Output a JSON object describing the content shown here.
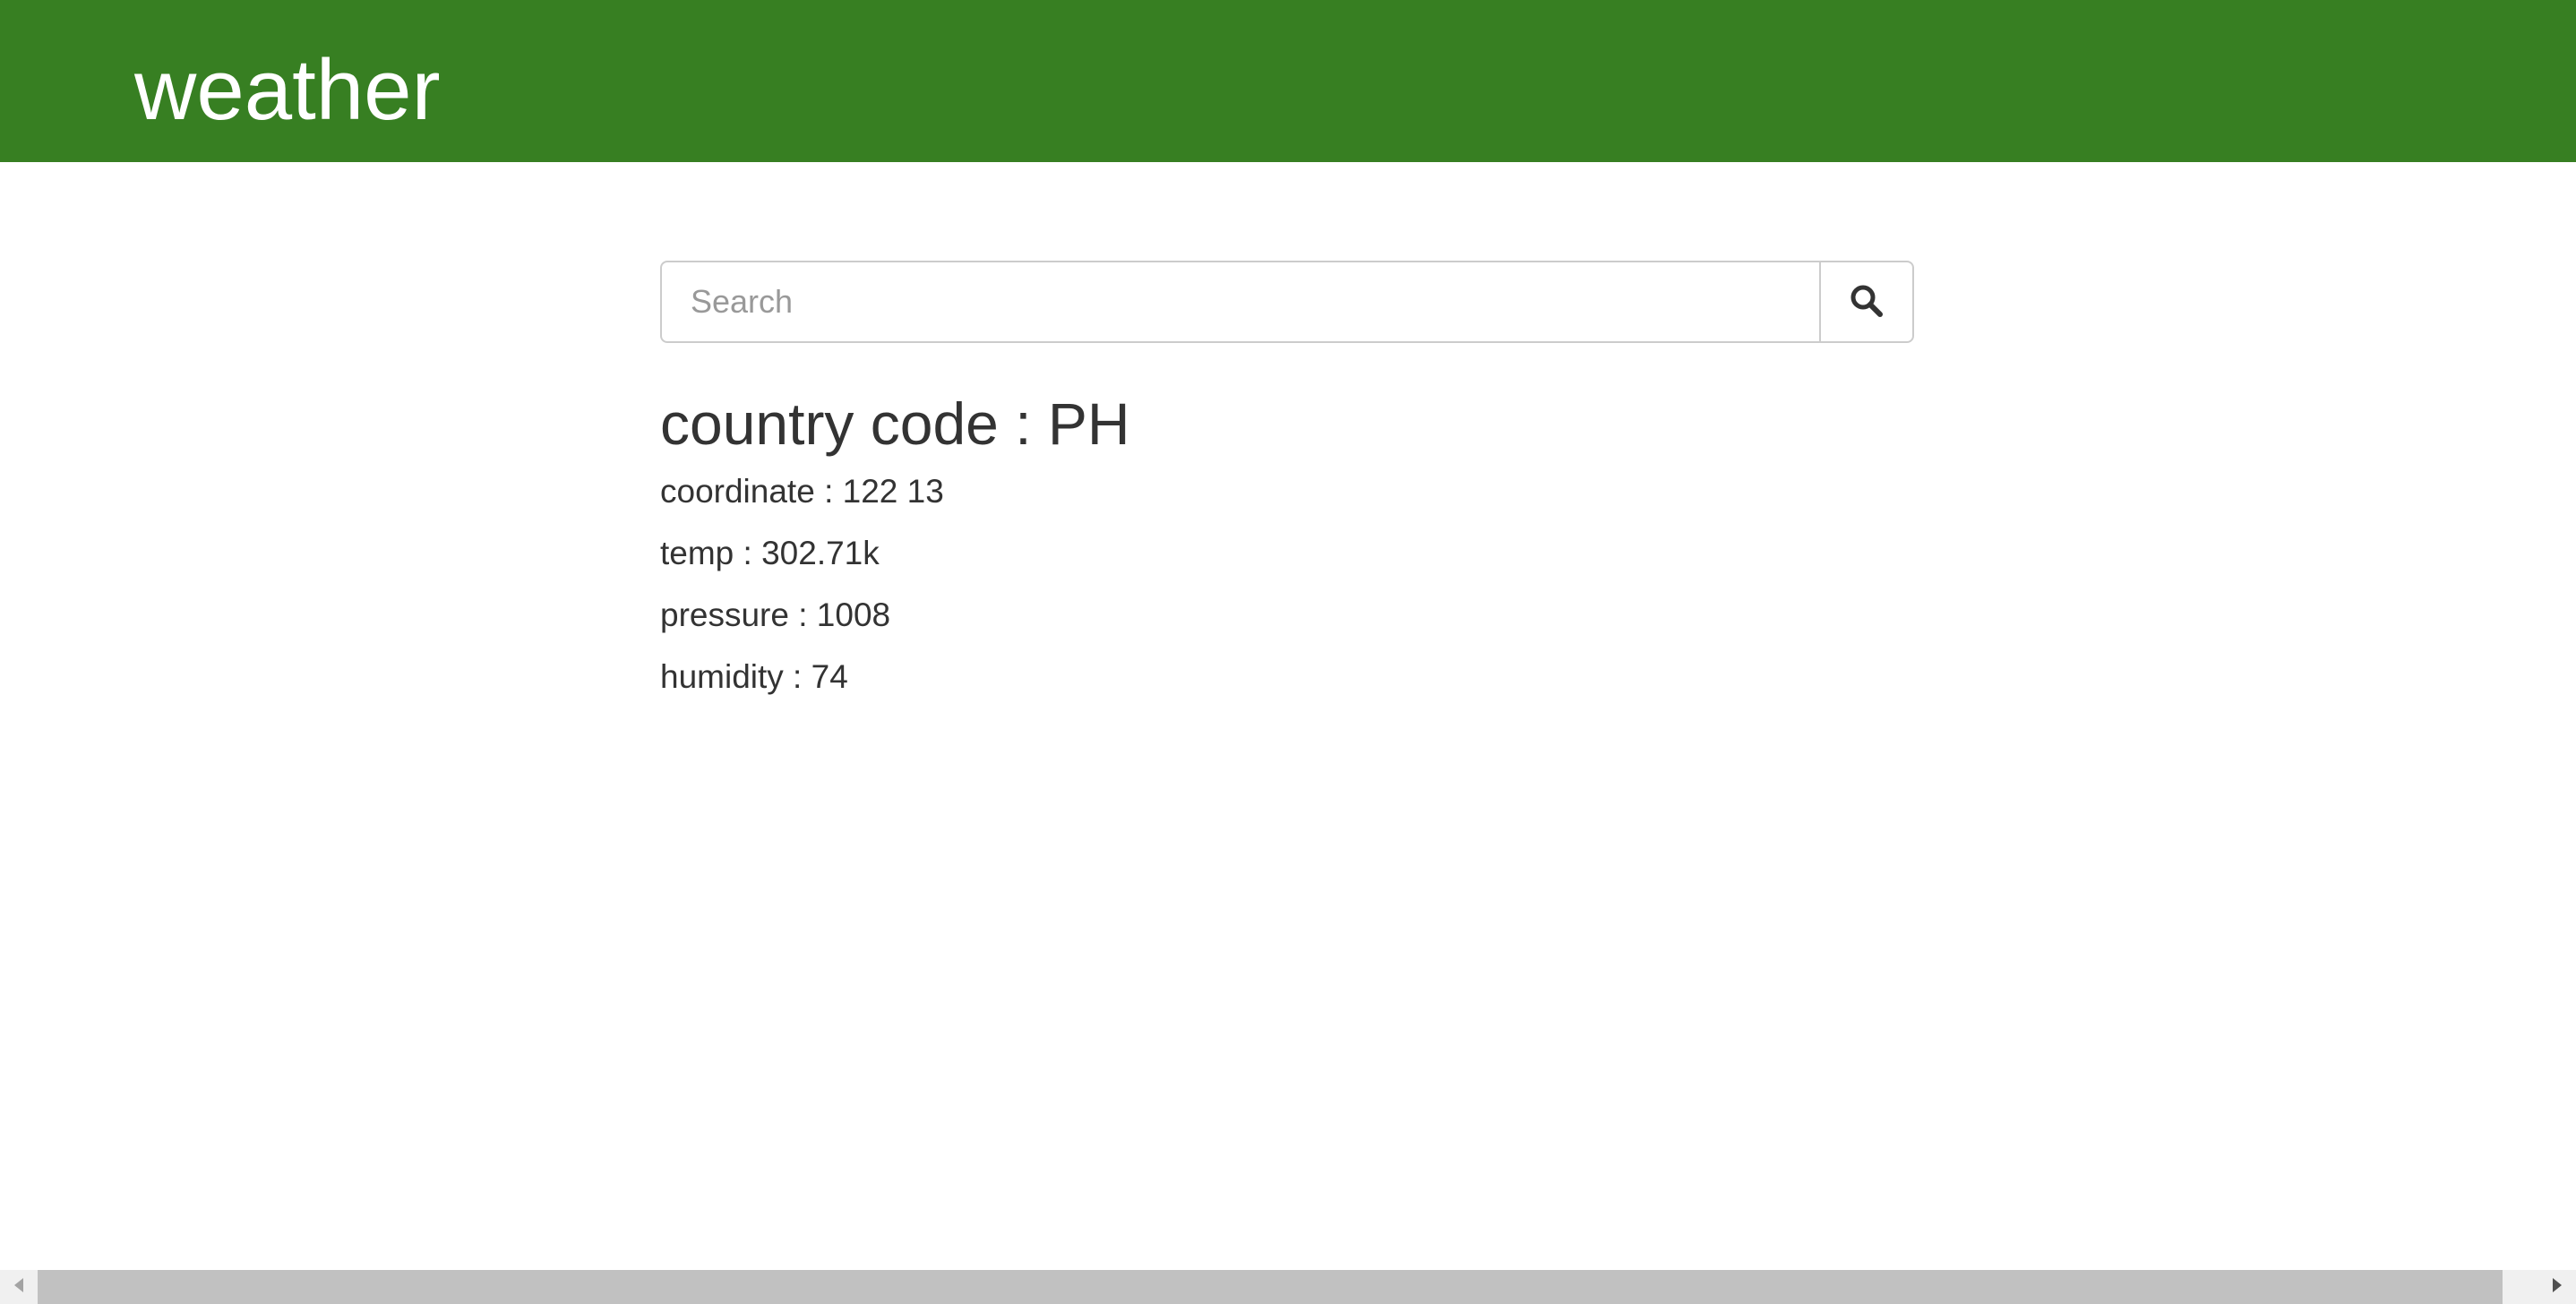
{
  "header": {
    "title": "weather",
    "background_color": "#377f22"
  },
  "search": {
    "placeholder": "Search",
    "value": "",
    "button_icon": "search-icon"
  },
  "result": {
    "country_line": "country code : PH",
    "coordinate_line": "coordinate : 122 13",
    "temp_line": "temp : 302.71k",
    "pressure_line": "pressure : 1008",
    "humidity_line": "humidity : 74"
  },
  "scrollbar": {
    "left_icon": "arrow-left-icon",
    "right_icon": "arrow-right-icon"
  }
}
